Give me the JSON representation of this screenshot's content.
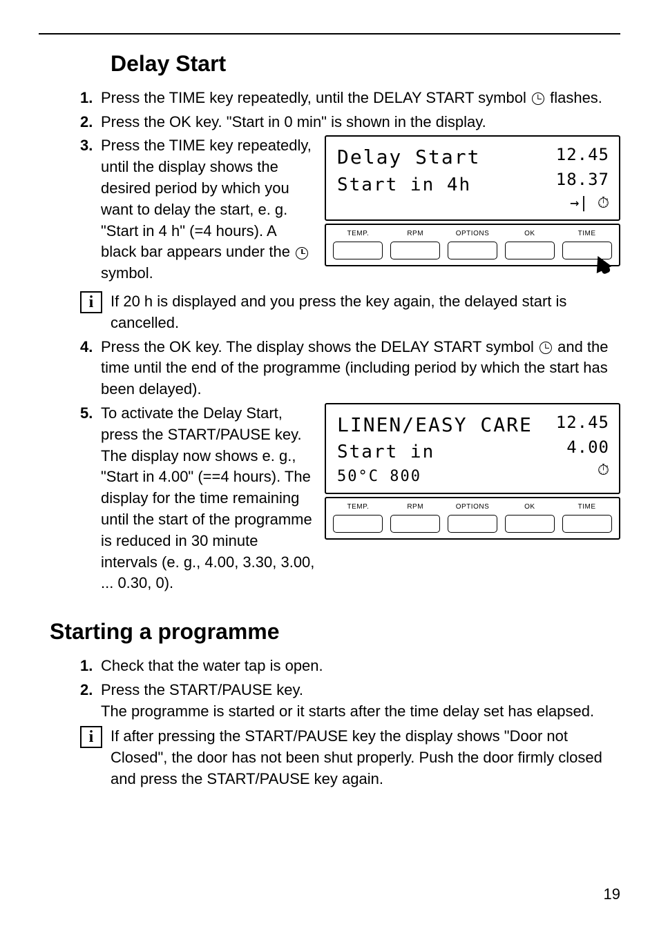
{
  "page": {
    "number": "19"
  },
  "delay_start": {
    "title": "Delay Start",
    "step1": {
      "num": "1.",
      "text_a": "Press the TIME key repeatedly, until the DELAY START symbol ",
      "text_b": " flashes."
    },
    "step2": {
      "num": "2.",
      "text": "Press the OK key. \"Start in 0 min\" is shown in the display."
    },
    "step3": {
      "num": "3.",
      "text_a": "Press the TIME key repeatedly, until the display shows the desired period by which you want to delay the start, e. g. \"Start in 4 h\" (=4 hours). A black bar appears under the ",
      "text_b": " symbol."
    },
    "info1": "If 20 h is displayed and you press the key again, the delayed start is cancelled.",
    "step4": {
      "num": "4.",
      "text_a": "Press the OK key. The display shows the DELAY START symbol ",
      "text_b": " and the time until the end of the programme (including period by which the start has been delayed)."
    },
    "step5": {
      "num": "5.",
      "text": "To activate the Delay Start, press the START/PAUSE key. The display now shows e. g., \"Start in 4.00\" (==4 hours). The display for the time remaining until the start of the programme is reduced in 30 minute intervals (e. g., 4.00, 3.30, 3.00, ... 0.30, 0)."
    }
  },
  "starting": {
    "title": "Starting a programme",
    "step1": {
      "num": "1.",
      "text": "Check that the water tap is open."
    },
    "step2": {
      "num": "2.",
      "text_a": "Press the START/PAUSE key.",
      "text_b": "The programme is started or it starts after the time delay set has elapsed."
    },
    "info": "If after pressing the START/PAUSE key the display shows \"Door not Closed\", the door has not been shut properly. Push the door firmly closed and press the START/PAUSE key again."
  },
  "panel_labels": {
    "temp": "TEMP.",
    "rpm": "RPM",
    "options": "OPTIONS",
    "ok": "OK",
    "time": "TIME"
  },
  "lcd1": {
    "line1": "Delay Start",
    "line2": "Start in 4h",
    "r1": "12.45",
    "r2": "18.37",
    "icons": "→| ⏱"
  },
  "lcd2": {
    "line1": "LINEN/EASY CARE",
    "line2": "Start in",
    "line3": "50°C 800",
    "r1": "12.45",
    "r2": "4.00",
    "icons": "⏱"
  }
}
